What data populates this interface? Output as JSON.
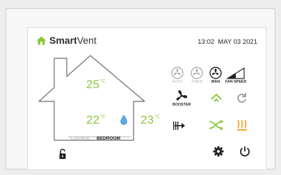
{
  "app": {
    "brand_bold": "Smart",
    "brand_light": "Vent"
  },
  "status": {
    "time": "13:02",
    "date": "MAY 03 2021"
  },
  "temperatures": {
    "upper": "25",
    "lower": "22",
    "outdoor": "23",
    "unit": "°C"
  },
  "zones": {
    "lounge": "LOUNGE",
    "bedroom": "BEDROOM"
  },
  "controls": {
    "auto": "AUTO",
    "timer": "TIMER",
    "manual": "MAN",
    "fan_speed": "FAN SPEED",
    "booster": "BOOSTER"
  },
  "colors": {
    "accent_green": "#8dc63f",
    "accent_orange": "#f39c12",
    "drop_blue": "#5aa9e6",
    "inactive_grey": "#b0b0b0",
    "active_dark": "#222222"
  },
  "icons": [
    "home-logo-icon",
    "auto-fan-icon",
    "timer-fan-icon",
    "manual-fan-icon",
    "fan-speed-icon",
    "booster-fan-icon",
    "up-arrow-icon",
    "refresh-icon",
    "filter-icon",
    "bypass-icon",
    "heater-icon",
    "humidity-drop-icon",
    "lock-icon",
    "settings-icon",
    "power-icon"
  ]
}
